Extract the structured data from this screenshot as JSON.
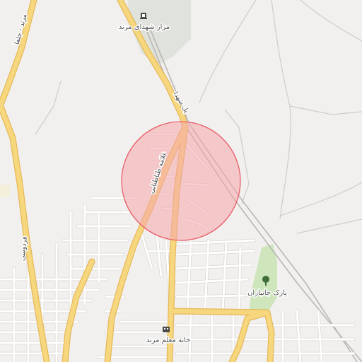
{
  "map": {
    "colors": {
      "background": "#f2f0ee",
      "major_road": "#f7d77e",
      "major_road_casing": "#e4b85a",
      "minor_road": "#ffffff",
      "minor_road_casing": "#d9d6d2",
      "railway": "#b9b6b2",
      "park": "#cfe6bd",
      "cemetery": "#dfe3dc",
      "radius_fill": "#f6a6ab",
      "radius_stroke": "#e9606a"
    },
    "labels": {
      "cemetery": "مزار شهدای مرند",
      "bridge": "پل شهدا",
      "street_tabatabaei": "علامه طباطبایی",
      "road_marand_jolfa": "مرند - جلفا",
      "road_ferdowsi": "فردوسی",
      "park_janbazan": "پارک جانبازان",
      "teacher_house": "خانه معلم مرند"
    },
    "icons": {
      "cemetery": "monument-icon",
      "park": "tree-icon",
      "teacher_house": "building-icon"
    },
    "overlay": {
      "shape": "circle",
      "meaning": "search-radius"
    }
  }
}
